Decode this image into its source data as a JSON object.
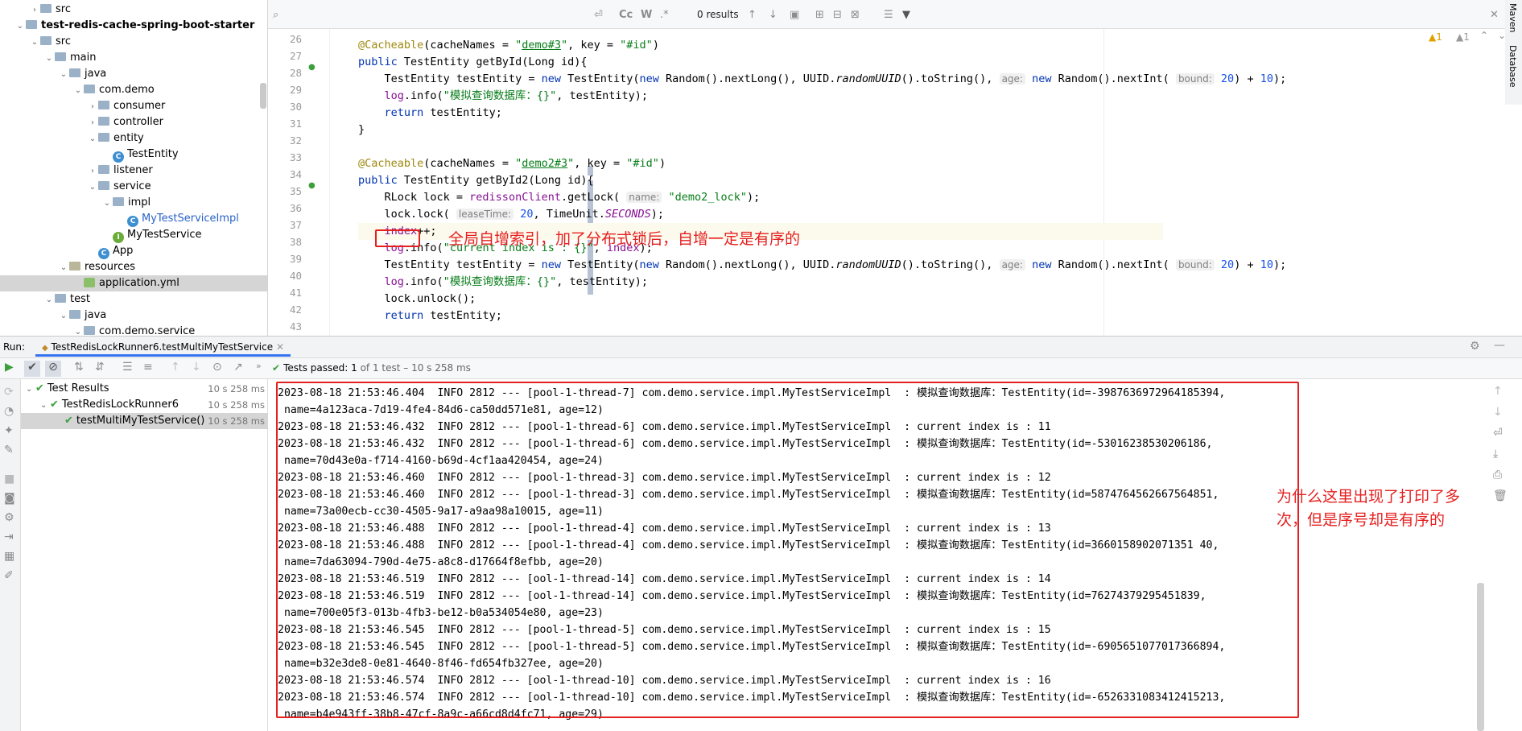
{
  "tree": {
    "items": [
      {
        "label": "src",
        "level": 2,
        "type": "folder",
        "arrow": "›"
      },
      {
        "label": "test-redis-cache-spring-boot-starter",
        "level": 1,
        "type": "module",
        "arrow": "⌄"
      },
      {
        "label": "src",
        "level": 2,
        "type": "folder",
        "arrow": "⌄"
      },
      {
        "label": "main",
        "level": 3,
        "type": "folder",
        "arrow": "⌄"
      },
      {
        "label": "java",
        "level": 4,
        "type": "folder",
        "arrow": "⌄"
      },
      {
        "label": "com.demo",
        "level": 5,
        "type": "folder",
        "arrow": "⌄"
      },
      {
        "label": "consumer",
        "level": 6,
        "type": "folder",
        "arrow": "›"
      },
      {
        "label": "controller",
        "level": 6,
        "type": "folder",
        "arrow": "›"
      },
      {
        "label": "entity",
        "level": 6,
        "type": "folder",
        "arrow": "⌄"
      },
      {
        "label": "TestEntity",
        "level": 7,
        "type": "class",
        "arrow": ""
      },
      {
        "label": "listener",
        "level": 6,
        "type": "folder",
        "arrow": "›"
      },
      {
        "label": "service",
        "level": 6,
        "type": "folder",
        "arrow": "⌄"
      },
      {
        "label": "impl",
        "level": 7,
        "type": "folder",
        "arrow": "⌄"
      },
      {
        "label": "MyTestServiceImpl",
        "level": 8,
        "type": "class",
        "arrow": ""
      },
      {
        "label": "MyTestService",
        "level": 7,
        "type": "interface",
        "arrow": ""
      },
      {
        "label": "App",
        "level": 6,
        "type": "class",
        "arrow": ""
      },
      {
        "label": "resources",
        "level": 4,
        "type": "resfolder",
        "arrow": "⌄"
      },
      {
        "label": "application.yml",
        "level": 5,
        "type": "yml",
        "arrow": ""
      },
      {
        "label": "test",
        "level": 3,
        "type": "folder",
        "arrow": "⌄"
      },
      {
        "label": "java",
        "level": 4,
        "type": "folder",
        "arrow": "⌄"
      },
      {
        "label": "com.demo.service",
        "level": 5,
        "type": "folder",
        "arrow": "⌄"
      }
    ]
  },
  "search": {
    "placeholder": "Q·",
    "results": "0 results",
    "cc": "Cc",
    "w": "W",
    "regex": ".*"
  },
  "editor": {
    "line_numbers": [
      "26",
      "27",
      "28",
      "29",
      "30",
      "31",
      "32",
      "33",
      "34",
      "35",
      "36",
      "37",
      "38",
      "39",
      "40",
      "41",
      "42",
      "43"
    ],
    "warnings_1": "▲1",
    "warnings_2": "▲1",
    "annotation": "全局自增索引，加了分布式锁后，自增一定是有序的"
  },
  "run": {
    "label": "Run:",
    "tab": "TestRedisLockRunner6.testMultiMyTestService",
    "status_prefix": "Tests passed:",
    "status_count": "1",
    "status_rest": "of 1 test – 10 s 258 ms"
  },
  "results": {
    "items": [
      {
        "label": "Test Results",
        "time": "10 s 258 ms"
      },
      {
        "label": "TestRedisLockRunner6",
        "time": "10 s 258 ms"
      },
      {
        "label": "testMultiMyTestService()",
        "time": "10 s 258 ms"
      }
    ]
  },
  "console": {
    "lines": [
      "2023-08-18 21:53:46.404  INFO 2812 --- [pool-1-thread-7] com.demo.service.impl.MyTestServiceImpl  : 模拟查询数据库：TestEntity(id=-3987636972964185394,",
      " name=4a123aca-7d19-4fe4-84d6-ca50dd571e81, age=12)",
      "2023-08-18 21:53:46.432  INFO 2812 --- [pool-1-thread-6] com.demo.service.impl.MyTestServiceImpl  : current index is : 11",
      "2023-08-18 21:53:46.432  INFO 2812 --- [pool-1-thread-6] com.demo.service.impl.MyTestServiceImpl  : 模拟查询数据库：TestEntity(id=-53016238530206186,",
      " name=70d43e0a-f714-4160-b69d-4cf1aa420454, age=24)",
      "2023-08-18 21:53:46.460  INFO 2812 --- [pool-1-thread-3] com.demo.service.impl.MyTestServiceImpl  : current index is : 12",
      "2023-08-18 21:53:46.460  INFO 2812 --- [pool-1-thread-3] com.demo.service.impl.MyTestServiceImpl  : 模拟查询数据库：TestEntity(id=5874764562667564851,",
      " name=73a00ecb-cc30-4505-9a17-a9aa98a10015, age=11)",
      "2023-08-18 21:53:46.488  INFO 2812 --- [pool-1-thread-4] com.demo.service.impl.MyTestServiceImpl  : current index is : 13",
      "2023-08-18 21:53:46.488  INFO 2812 --- [pool-1-thread-4] com.demo.service.impl.MyTestServiceImpl  : 模拟查询数据库：TestEntity(id=3660158902071351 40,",
      " name=7da63094-790d-4e75-a8c8-d17664f8efbb, age=20)",
      "2023-08-18 21:53:46.519  INFO 2812 --- [ool-1-thread-14] com.demo.service.impl.MyTestServiceImpl  : current index is : 14",
      "2023-08-18 21:53:46.519  INFO 2812 --- [ool-1-thread-14] com.demo.service.impl.MyTestServiceImpl  : 模拟查询数据库：TestEntity(id=76274379295451839,",
      " name=700e05f3-013b-4fb3-be12-b0a534054e80, age=23)",
      "2023-08-18 21:53:46.545  INFO 2812 --- [pool-1-thread-5] com.demo.service.impl.MyTestServiceImpl  : current index is : 15",
      "2023-08-18 21:53:46.545  INFO 2812 --- [pool-1-thread-5] com.demo.service.impl.MyTestServiceImpl  : 模拟查询数据库：TestEntity(id=-6905651077017366894,",
      " name=b32e3de8-0e81-4640-8f46-fd654fb327ee, age=20)",
      "2023-08-18 21:53:46.574  INFO 2812 --- [ool-1-thread-10] com.demo.service.impl.MyTestServiceImpl  : current index is : 16",
      "2023-08-18 21:53:46.574  INFO 2812 --- [ool-1-thread-10] com.demo.service.impl.MyTestServiceImpl  : 模拟查询数据库：TestEntity(id=-6526331083412415213,",
      " name=b4e943ff-38b8-47cf-8a9c-a66cd8d4fc71, age=29)"
    ],
    "annotation_line1": "为什么这里出现了打印了多",
    "annotation_line2": "次，但是序号却是有序的"
  },
  "side": {
    "maven": "Maven",
    "database": "Database"
  },
  "colors": {
    "accent_red": "#e52020",
    "pass_green": "#3c9f3c",
    "keyword": "#0033b3",
    "string": "#067d17",
    "annotation": "#9e880d",
    "number": "#1750eb"
  }
}
